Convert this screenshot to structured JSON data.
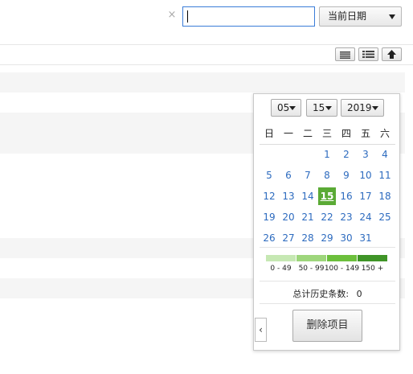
{
  "topbar": {
    "clear_symbol": "×",
    "search_value": "",
    "date_select_label": "当前日期"
  },
  "calendar": {
    "month": "05",
    "day": "15",
    "year": "2019",
    "weekdays": [
      "日",
      "一",
      "二",
      "三",
      "四",
      "五",
      "六"
    ],
    "leading_blanks": 3,
    "days": [
      "1",
      "2",
      "3",
      "4",
      "5",
      "6",
      "7",
      "8",
      "9",
      "10",
      "11",
      "12",
      "13",
      "14",
      "15",
      "16",
      "17",
      "18",
      "19",
      "20",
      "21",
      "22",
      "23",
      "24",
      "25",
      "26",
      "27",
      "28",
      "29",
      "30",
      "31"
    ],
    "selected_day": "15",
    "legend": [
      {
        "label": "0 - 49",
        "color": "#c6e8b3"
      },
      {
        "label": "50 - 99",
        "color": "#9ed67c"
      },
      {
        "label": "100 - 149",
        "color": "#6cbf3c"
      },
      {
        "label": "150 +",
        "color": "#3f9427"
      }
    ],
    "total_label": "总计历史条数:",
    "total_value": "0",
    "collapse_symbol": "‹",
    "delete_label": "删除项目"
  }
}
